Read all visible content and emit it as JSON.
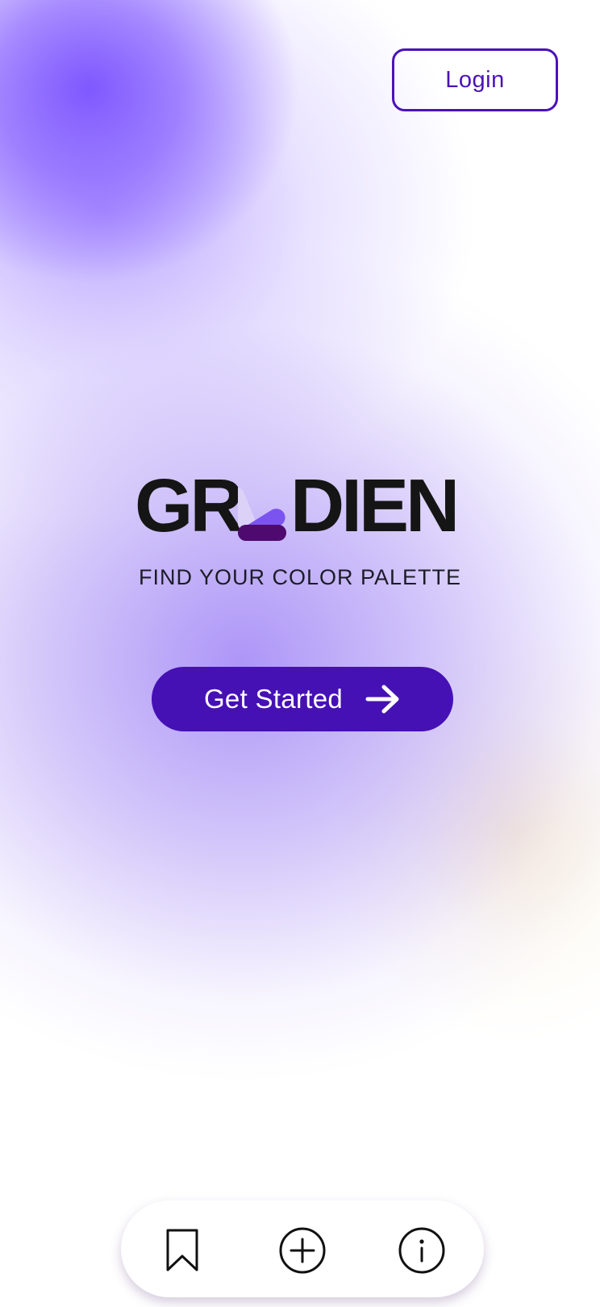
{
  "header": {
    "login_label": "Login"
  },
  "logo": {
    "text_left": "GR",
    "text_right": "DIEN",
    "mark_icon": "palette-swatch-icon",
    "mark_colors": [
      "#dcd2f8",
      "#7b54f0",
      "#4e0a6e"
    ]
  },
  "hero": {
    "tagline": "FIND YOUR COLOR PALETTE",
    "cta_label": "Get Started",
    "cta_icon": "arrow-right-icon"
  },
  "bottom_nav": {
    "items": [
      {
        "icon": "bookmark-icon"
      },
      {
        "icon": "plus-circle-icon"
      },
      {
        "icon": "info-icon"
      }
    ]
  },
  "colors": {
    "accent": "#4511b5",
    "logo_text": "#151515",
    "background_glow": "#8058ff",
    "warm_glow": "#faeed2"
  }
}
